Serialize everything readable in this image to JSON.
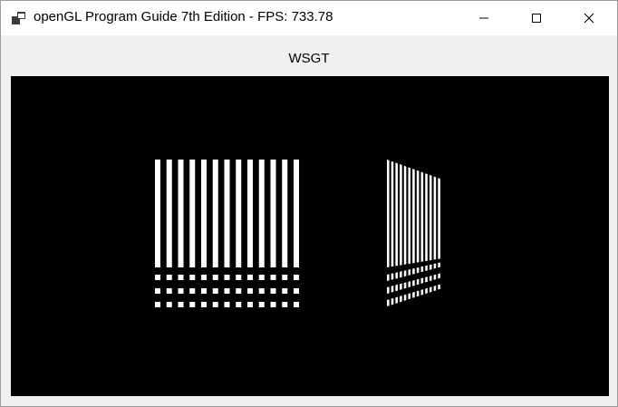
{
  "window": {
    "title": "openGL Program Guide 7th Edition - FPS: 733.78",
    "icon": "app-window-icon",
    "controls": {
      "minimize": "minimize-icon",
      "maximize": "maximize-icon",
      "close": "close-icon"
    }
  },
  "content": {
    "label": "WSGT",
    "viewport_background": "#000000",
    "stripe_color": "#ffffff"
  }
}
